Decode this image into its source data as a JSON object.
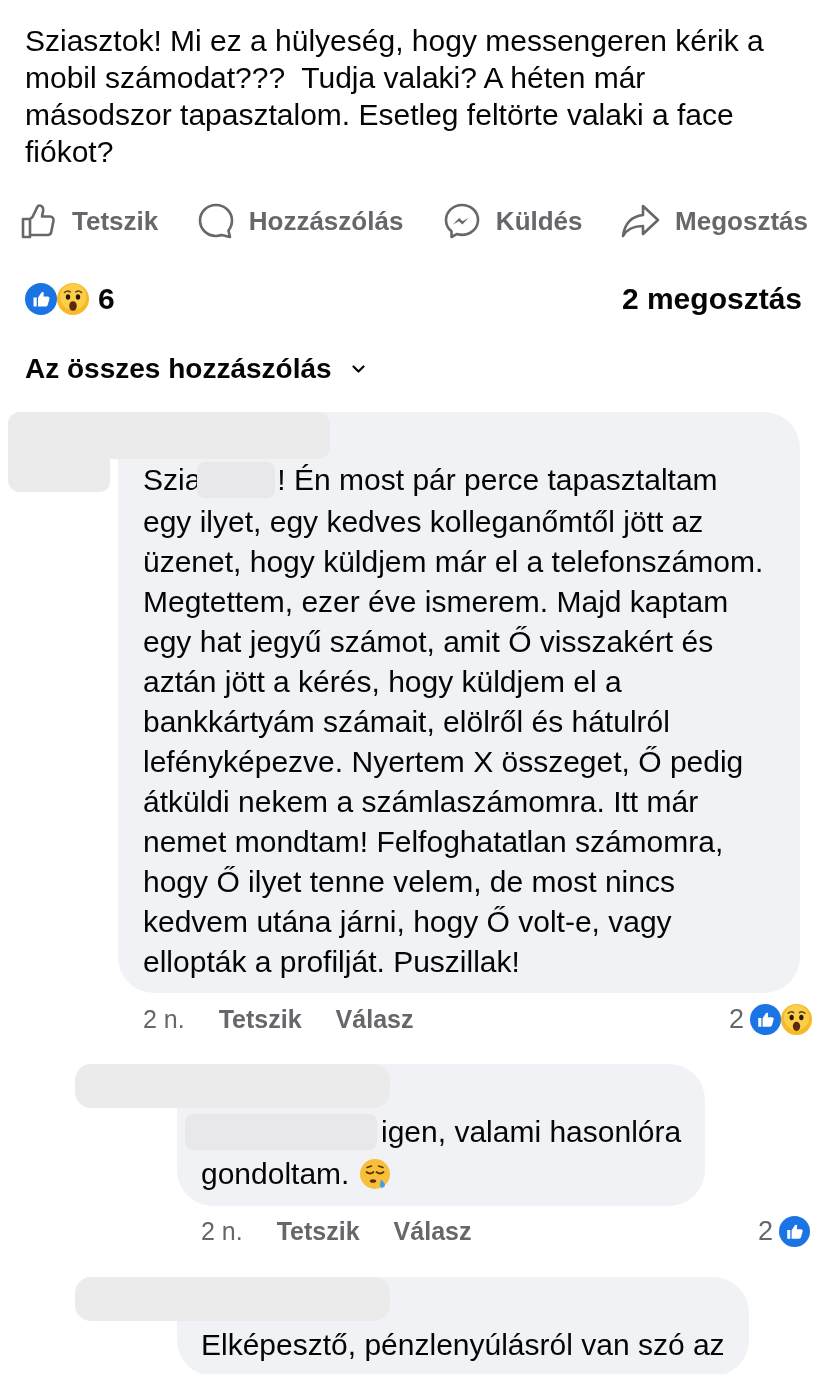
{
  "post": {
    "text": "Sziasztok! Mi ez a hülyeség, hogy messengeren kérik a mobil számodat???  Tudja valaki? A héten már másodszor tapasztalom. Esetleg feltörte valaki a face fiókot?"
  },
  "actions": [
    {
      "kind": "like",
      "label": "Tetszik"
    },
    {
      "kind": "comment",
      "label": "Hozzászólás"
    },
    {
      "kind": "send",
      "label": "Küldés"
    },
    {
      "kind": "share",
      "label": "Megosztás"
    }
  ],
  "stats": {
    "reactions": [
      {
        "kind": "like"
      },
      {
        "kind": "wow"
      }
    ],
    "reaction_count": "6",
    "shares": "2 megosztás"
  },
  "comment_filter": {
    "label": "Az összes hozzászólás"
  },
  "comments": [
    {
      "kind": "comment",
      "author_redacted": true,
      "body": [
        [
          {
            "kind": "text",
            "text": "Szia"
          },
          {
            "kind": "redacted"
          },
          {
            "kind": "text",
            "text": "! Én most pár perce tapasztaltam"
          }
        ],
        [
          {
            "kind": "text",
            "text": "egy ilyet, egy kedves kolleganőmtől jött az üzenet, hogy küldjem már el a telefonszámom. Megtettem, ezer éve ismerem. Majd kaptam egy hat jegyű számot, amit Ő visszakért és aztán jött a kérés, hogy küldjem el a bankkártyám számait, elölről és hátulról lefényképezve. Nyertem X összeget, Ő pedig átküldi nekem a számlaszámomra. Itt már nemet mondtam! Felfoghatatlan számomra, hogy Ő ilyet tenne velem, de most nincs kedvem utána járni, hogy Ő volt-e, vagy ellopták a profilját. Puszillak!"
          }
        ]
      ],
      "time": "2 n.",
      "actions": [
        "Tetszik",
        "Válasz"
      ],
      "reaction_count": "2",
      "reactions": [
        {
          "kind": "like"
        },
        {
          "kind": "wow"
        }
      ]
    },
    {
      "kind": "reply",
      "author_redacted": true,
      "body": [
        [
          {
            "kind": "redacted"
          },
          {
            "kind": "text",
            "text": "igen, valami hasonlóra"
          }
        ],
        [
          {
            "kind": "text",
            "text": "gondoltam."
          },
          {
            "kind": "emoji"
          }
        ]
      ],
      "time": "2 n.",
      "actions": [
        "Tetszik",
        "Válasz"
      ],
      "reaction_count": "2",
      "reactions": [
        {
          "kind": "like"
        }
      ]
    },
    {
      "kind": "reply",
      "author_redacted": true,
      "body": [
        [
          {
            "kind": "text",
            "text": "Elképesztő, pénzlenyúlásról van szó az"
          }
        ]
      ]
    }
  ]
}
